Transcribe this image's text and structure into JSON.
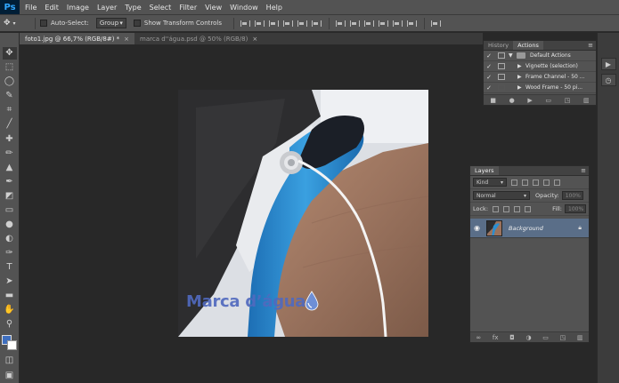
{
  "app": {
    "logo": "Ps"
  },
  "menu": [
    "File",
    "Edit",
    "Image",
    "Layer",
    "Type",
    "Select",
    "Filter",
    "View",
    "Window",
    "Help"
  ],
  "options": {
    "auto_select_label": "Auto-Select:",
    "auto_select_value": "Group",
    "transform_label": "Show Transform Controls"
  },
  "doc_tabs": [
    {
      "label": "foto1.jpg @ 66,7% (RGB/8#) *",
      "active": true
    },
    {
      "label": "marca d''água.psd @ 50% (RGB/8)",
      "active": false
    }
  ],
  "tab_close": "×",
  "canvas": {
    "watermark_text": "Marca d’água"
  },
  "actions_panel": {
    "tabs": [
      "History",
      "Actions"
    ],
    "active_tab": "Actions",
    "rows": [
      {
        "label": "Default Actions",
        "checked": true,
        "folder": true
      },
      {
        "label": "Vignette (selection)",
        "checked": true,
        "folder": false
      },
      {
        "label": "Frame Channel - 50 ...",
        "checked": true,
        "folder": false
      },
      {
        "label": "Wood Frame - 50 pi...",
        "checked": true,
        "folder": false
      }
    ]
  },
  "layers_panel": {
    "tab": "Layers",
    "filter_kind": "Kind",
    "blend_mode": "Normal",
    "opacity_label": "Opacity:",
    "opacity_value": "100%",
    "lock_label": "Lock:",
    "fill_label": "Fill:",
    "fill_value": "100%",
    "layer_name": "Background"
  },
  "colors": {
    "foreground": "#3f6fbf",
    "background": "#ffffff",
    "ui_dark": "#282828",
    "ui_panel": "#535353",
    "selected_layer": "#5a6e88"
  },
  "icons": {
    "tools": [
      "move-icon",
      "marquee-icon",
      "lasso-icon",
      "quick-select-icon",
      "crop-icon",
      "eyedropper-icon",
      "healing-icon",
      "brush-icon",
      "stamp-icon",
      "history-brush-icon",
      "eraser-icon",
      "gradient-icon",
      "blur-icon",
      "dodge-icon",
      "pen-icon",
      "type-icon",
      "path-select-icon",
      "shape-icon",
      "hand-icon",
      "zoom-icon"
    ]
  }
}
